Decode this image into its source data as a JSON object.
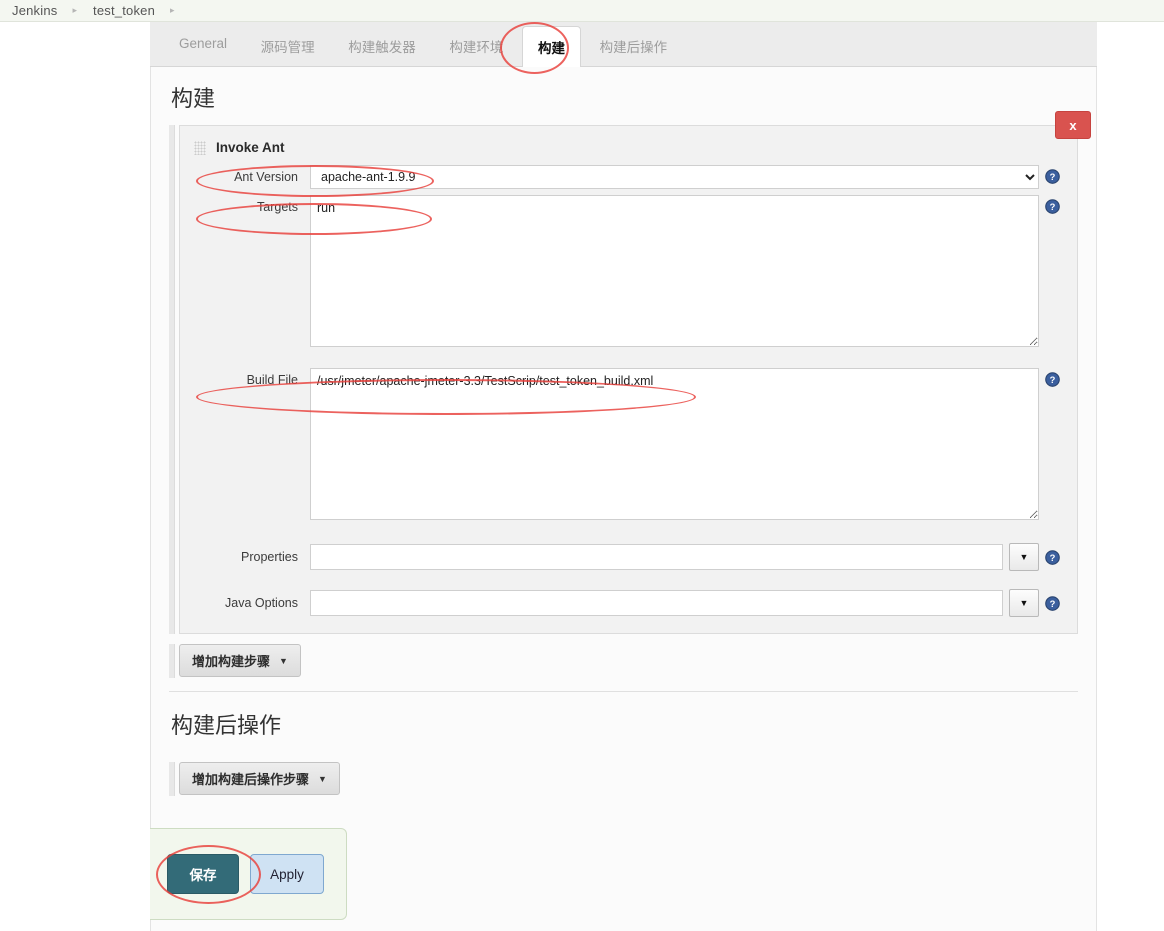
{
  "breadcrumb": {
    "items": [
      "Jenkins",
      "test_token"
    ],
    "separator": "▸"
  },
  "tabs": [
    {
      "label": "General",
      "active": false
    },
    {
      "label": "源码管理",
      "active": false
    },
    {
      "label": "构建触发器",
      "active": false
    },
    {
      "label": "构建环境",
      "active": false
    },
    {
      "label": "构建",
      "active": true
    },
    {
      "label": "构建后操作",
      "active": false
    }
  ],
  "build_section": {
    "title": "构建",
    "block_title": "Invoke Ant",
    "delete_label": "x",
    "add_step_label": "增加构建步骤",
    "caret": "▼",
    "fields": {
      "ant_version": {
        "label": "Ant Version",
        "value": "apache-ant-1.9.9",
        "options": [
          "apache-ant-1.9.9"
        ]
      },
      "targets": {
        "label": "Targets",
        "value": "run",
        "placeholder": ""
      },
      "build_file": {
        "label": "Build File",
        "value": "/usr/jmeter/apache-jmeter-3.3/TestScrip/test_token_build.xml",
        "placeholder": ""
      },
      "properties": {
        "label": "Properties",
        "value": "",
        "placeholder": ""
      },
      "java_options": {
        "label": "Java Options",
        "value": "",
        "placeholder": ""
      }
    }
  },
  "post_build_section": {
    "title": "构建后操作",
    "add_step_label": "增加构建后操作步骤",
    "caret": "▼"
  },
  "footer": {
    "save_label": "保存",
    "apply_label": "Apply"
  },
  "colors": {
    "accent_save": "#336b78",
    "accent_apply": "#cfe2f3",
    "delete_red": "#d9534f",
    "help_blue": "#3b5f9e",
    "annotation_red": "#e8403a"
  }
}
